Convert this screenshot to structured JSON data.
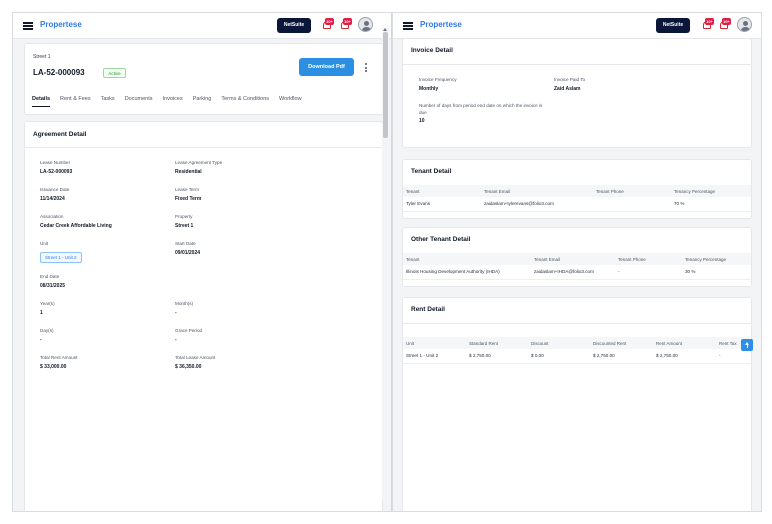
{
  "left_topbar": {
    "brand": "Propertese",
    "netsuite_label": "NetSuite",
    "notification_badges": [
      "10+",
      "10+"
    ]
  },
  "right_topbar": {
    "brand": "Propertese",
    "netsuite_label": "NetSuite",
    "notification_badges": [
      "10+",
      "10+"
    ]
  },
  "lease_header": {
    "property_name": "Street 1",
    "lease_number": "LA-52-000093",
    "status": "Active",
    "download_button": "Download Pdf",
    "tabs": [
      "Details",
      "Rent & Fees",
      "Tasks",
      "Documents",
      "Invoices",
      "Parking",
      "Terms & Conditions",
      "Workflow"
    ],
    "active_tab": "Details"
  },
  "agreement_detail": {
    "title": "Agreement Detail",
    "fields": [
      {
        "label": "Lease Number",
        "value": "LA-52-000093"
      },
      {
        "label": "Lease Agreement Type",
        "value": "Residential"
      },
      {
        "label": "Issuance Date",
        "value": "11/14/2024"
      },
      {
        "label": "Lease Term",
        "value": "Fixed Term"
      },
      {
        "label": "Association",
        "value": "Cedar Creek Affordable Living"
      },
      {
        "label": "Property",
        "value": "Street 1"
      },
      {
        "label": "Unit",
        "value": "Street 1 - Unit 2"
      },
      {
        "label": "Start Date",
        "value": "09/01/2024"
      },
      {
        "label": "End Date",
        "value": "08/31/2025"
      },
      {
        "label": "Year(s)",
        "value": "1"
      },
      {
        "label": "Month(s)",
        "value": "-"
      },
      {
        "label": "Day(s)",
        "value": "-"
      },
      {
        "label": "Grace Period",
        "value": "-"
      },
      {
        "label": "Total Rent Amount",
        "value": "$ 33,000.00"
      },
      {
        "label": "Total Lease Amount",
        "value": "$ 36,350.00"
      }
    ]
  },
  "invoice_detail": {
    "title": "Invoice Detail",
    "fields": [
      {
        "label": "Invoice Frequency",
        "value": "Monthly"
      },
      {
        "label": "Invoice Paid To",
        "value": "Zaid Aslam"
      },
      {
        "label": "Number of days from period end date on which the invoice is due",
        "value": "10"
      }
    ]
  },
  "tenant_detail": {
    "title": "Tenant Detail",
    "headers": [
      "Tenant",
      "Tenant Email",
      "Tenant Phone",
      "Tenancy Percentage"
    ],
    "rows": [
      [
        "Tyler Evans",
        "zaidaslam+tylerevans@folio3.com",
        "",
        "70 %"
      ]
    ]
  },
  "other_tenant_detail": {
    "title": "Other Tenant Detail",
    "headers": [
      "Tenant",
      "Tenant Email",
      "Tenant Phone",
      "Tenancy Percentage"
    ],
    "rows": [
      [
        "Illinois Housing Development Authority (IHDA)",
        "zaidaslam+IHDA@folio3.com",
        "-",
        "30 %"
      ]
    ]
  },
  "rent_detail": {
    "title": "Rent Detail",
    "headers": [
      "Unit",
      "Standard Rent",
      "Discount",
      "Discounted Rent",
      "Rent Amount",
      "Rent Tax"
    ],
    "rows": [
      [
        "Street 1 - Unit 2",
        "$ 2,750.00",
        "$ 0.00",
        "$ 2,750.00",
        "$ 2,750.00",
        "-"
      ]
    ]
  }
}
